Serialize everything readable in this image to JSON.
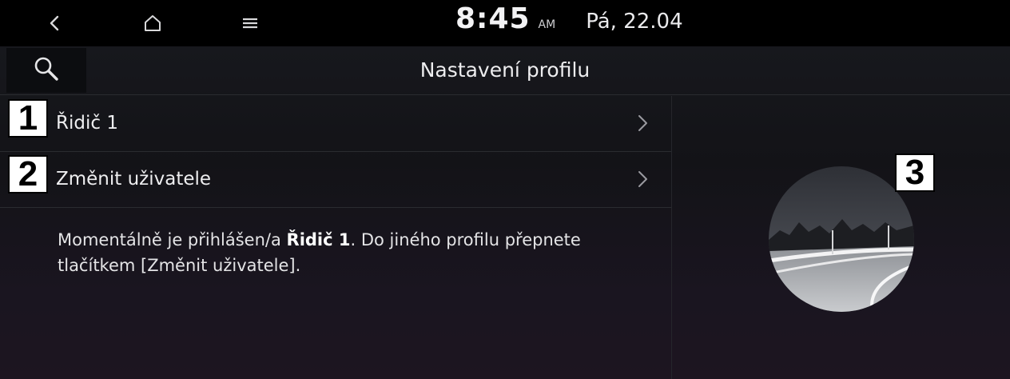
{
  "status_bar": {
    "time": "8:45",
    "ampm": "AM",
    "date": "Pá, 22.04",
    "icons": [
      "back-icon",
      "home-icon",
      "menu-icon"
    ]
  },
  "header": {
    "title": "Nastavení profilu",
    "search_icon": "search-icon"
  },
  "menu": {
    "items": [
      {
        "label": "Řidič 1",
        "callout": "1"
      },
      {
        "label": "Změnit uživatele",
        "callout": "2"
      }
    ]
  },
  "info": {
    "part1": "Momentálně je přihlášen/a ",
    "driver": "Řidič 1",
    "part2": ". Do jiného profilu přepnete tlačítkem [Změnit uživatele]."
  },
  "profile_image": {
    "callout": "3"
  },
  "colors": {
    "background": "#000000",
    "screen": "#16161b",
    "text": "#eeeef0",
    "divider": "#2a2b30"
  }
}
